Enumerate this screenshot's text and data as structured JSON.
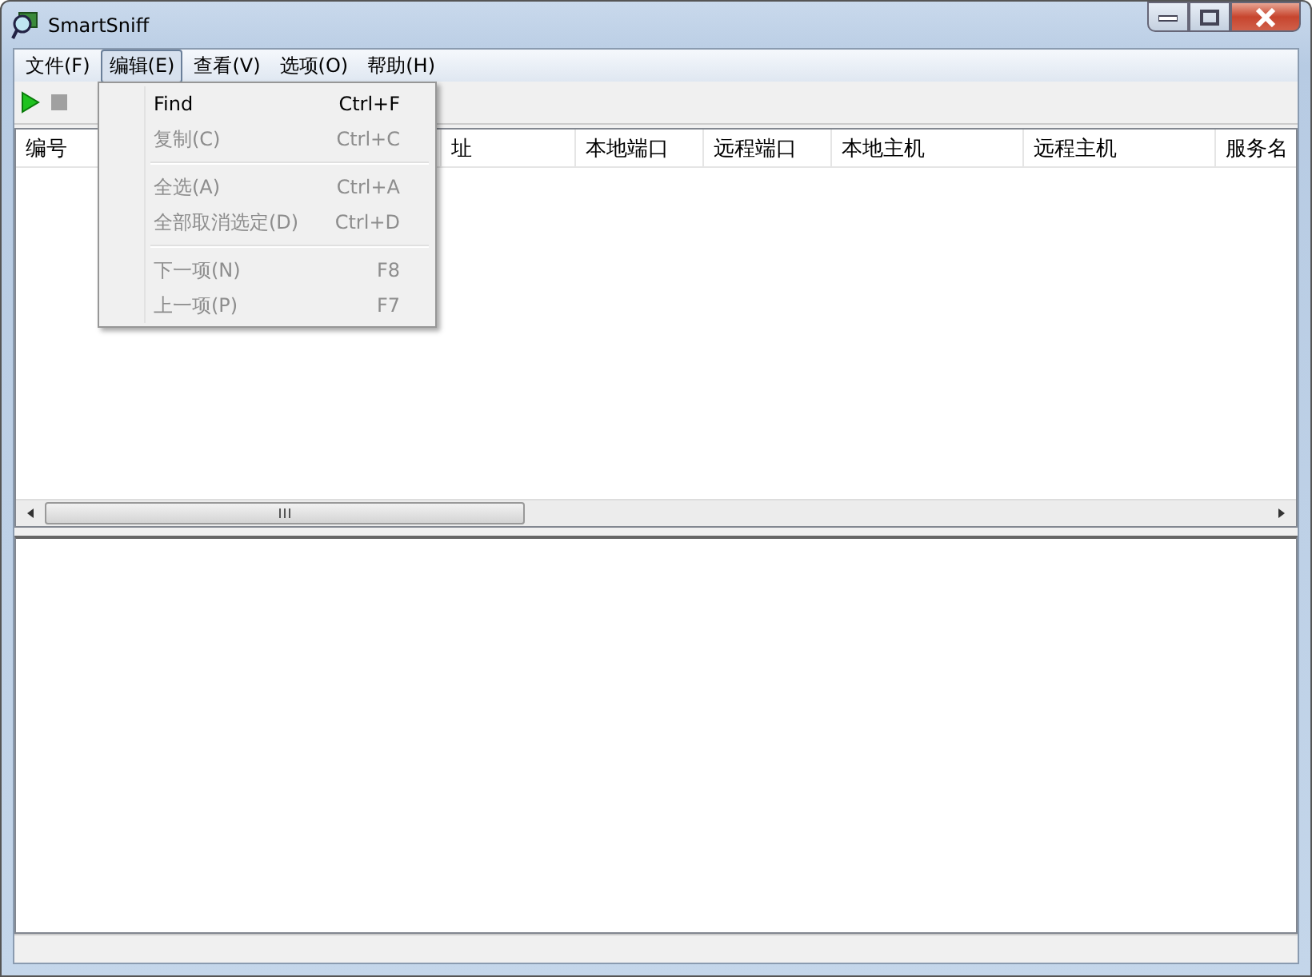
{
  "window": {
    "title": "SmartSniff"
  },
  "menubar": [
    {
      "label": "文件(F)",
      "selected": false
    },
    {
      "label": "编辑(E)",
      "selected": true
    },
    {
      "label": "查看(V)",
      "selected": false
    },
    {
      "label": "选项(O)",
      "selected": false
    },
    {
      "label": "帮助(H)",
      "selected": false
    }
  ],
  "toolbar": [
    {
      "kind": "start",
      "disabled": false
    },
    {
      "kind": "stop",
      "disabled": true
    }
  ],
  "table": {
    "columns": [
      {
        "label": "编号"
      },
      {},
      {
        "label": "址"
      },
      {
        "label": "本地端口"
      },
      {
        "label": "远程端口"
      },
      {
        "label": "本地主机"
      },
      {
        "label": "远程主机"
      },
      {
        "label": "服务名"
      }
    ]
  },
  "menu": [
    {
      "kind": "item",
      "label": "Find",
      "shortcut": "Ctrl+F",
      "disabled": false
    },
    {
      "kind": "item",
      "label": "复制(C)",
      "shortcut": "Ctrl+C",
      "disabled": true
    },
    {
      "kind": "separator"
    },
    {
      "kind": "item",
      "label": "全选(A)",
      "shortcut": "Ctrl+A",
      "disabled": true
    },
    {
      "kind": "item",
      "label": "全部取消选定(D)",
      "shortcut": "Ctrl+D",
      "disabled": true
    },
    {
      "kind": "separator"
    },
    {
      "kind": "item",
      "label": "下一项(N)",
      "shortcut": "F8",
      "disabled": true
    },
    {
      "kind": "item",
      "label": "上一项(P)",
      "shortcut": "F7",
      "disabled": true
    }
  ]
}
